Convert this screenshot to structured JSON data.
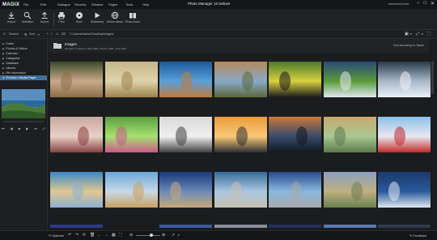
{
  "app": {
    "logo": "MAGIX",
    "title": "Photo Manager 16 Deluxe",
    "mode": "Advanced mode",
    "min": "–",
    "max": "□",
    "close": "✕"
  },
  "menu": [
    "File",
    "Edit",
    "Dialogue",
    "Security",
    "Window",
    "Pages",
    "Tools",
    "Help"
  ],
  "toolbar": [
    {
      "label": "Import",
      "icon": "import-icon"
    },
    {
      "label": "Selection",
      "icon": "magnifier-icon"
    },
    {
      "label": "Export",
      "icon": "export-icon"
    },
    {
      "label": "Print",
      "icon": "print-icon"
    },
    {
      "label": "Burn",
      "icon": "disc-icon"
    },
    {
      "label": "Slideshow",
      "icon": "play-icon"
    },
    {
      "label": "Online album",
      "icon": "globe-icon"
    },
    {
      "label": "Photo book",
      "icon": "book-icon"
    }
  ],
  "nav": {
    "search": "Search",
    "sort": "Sort",
    "path": "C:\\Users\\Name\\Desktop\\images"
  },
  "sidebar": {
    "items": [
      {
        "label": "Folder"
      },
      {
        "label": "Photos & Videos"
      },
      {
        "label": "Calendar"
      },
      {
        "label": "Categories"
      },
      {
        "label": "Database"
      },
      {
        "label": "Albums"
      },
      {
        "label": "File information"
      },
      {
        "label": "Preview / Media Player",
        "active": true
      }
    ]
  },
  "folder": {
    "name": "Images",
    "info": "444 files | 0 folders | 180.1 MB | Janvier 1998 - Juni 2019",
    "sort": "Sort according to: Name"
  },
  "status": {
    "optimize": "Optimize",
    "feedback": "Feedback"
  },
  "thumbs": [
    {
      "a": "#3a4a2a",
      "b": "#c9a98a",
      "c": "#8a6e4a"
    },
    {
      "a": "#c8b48a",
      "b": "#e0d4a8",
      "c": "#9b8050"
    },
    {
      "a": "#1e5a9a",
      "b": "#5aa0d8",
      "c": "#c07a3a"
    },
    {
      "a": "#b48a5a",
      "b": "#8aa8c8",
      "c": "#5a6a3a"
    },
    {
      "a": "#4a7a2a",
      "b": "#d8d040",
      "c": "#1a1a1a"
    },
    {
      "a": "#2a4a7a",
      "b": "#5a9a3a",
      "c": "#e0e8f0"
    },
    {
      "a": "#2a3a4a",
      "b": "#a8b8c8",
      "c": "#e8f0f8"
    },
    {
      "a": "#c8a8a0",
      "b": "#e8d0c8",
      "c": "#884040"
    },
    {
      "a": "#5aa040",
      "b": "#a8e070",
      "c": "#c85a8a"
    },
    {
      "a": "#d8d8d8",
      "b": "#f0f0f0",
      "c": "#404040"
    },
    {
      "a": "#e89a3a",
      "b": "#f8c878",
      "c": "#303030"
    },
    {
      "a": "#c87a3a",
      "b": "#3a4a6a",
      "c": "#101820"
    },
    {
      "a": "#c8a870",
      "b": "#a8c890",
      "c": "#5a7a4a"
    },
    {
      "a": "#8ac0e8",
      "b": "#e8e8f0",
      "c": "#c02a2a"
    },
    {
      "a": "#3a88c8",
      "b": "#e0c890",
      "c": "#8ab0d0"
    },
    {
      "a": "#6aa8d8",
      "b": "#c8d8e8",
      "c": "#c8a060"
    },
    {
      "a": "#1a3a7a",
      "b": "#6a8ab8",
      "c": "#c8a878"
    },
    {
      "a": "#3a6a9a",
      "b": "#a8c8e0",
      "c": "#c8c0b0"
    },
    {
      "a": "#2a4a8a",
      "b": "#8ab8e0",
      "c": "#a8a8a8"
    },
    {
      "a": "#8aa0c0",
      "b": "#c0b080",
      "c": "#6a8050"
    },
    {
      "a": "#1a3a6a",
      "b": "#2a5a9a",
      "c": "#e0e8f0"
    }
  ]
}
